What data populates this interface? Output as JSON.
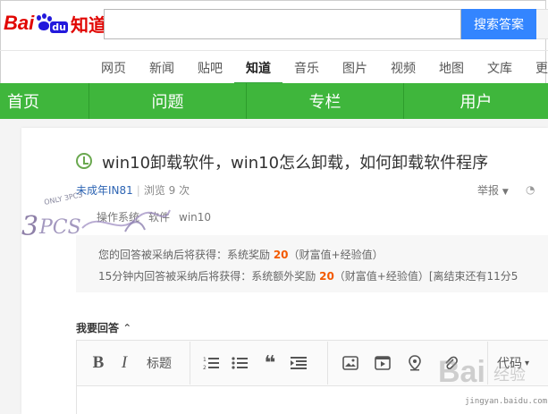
{
  "header": {
    "logo_bai": "Bai",
    "logo_du": "du",
    "logo_zhidao": "知道",
    "search_placeholder": "",
    "search_button": "搜索答案"
  },
  "nav": {
    "items": [
      "网页",
      "新闻",
      "贴吧",
      "知道",
      "音乐",
      "图片",
      "视频",
      "地图",
      "文库",
      "更"
    ],
    "active": "知道"
  },
  "greenbar": {
    "items": [
      "首页",
      "问题",
      "专栏",
      "用户"
    ]
  },
  "question": {
    "title": "win10卸载软件，win10怎么卸载，如何卸载软件程序",
    "asker": "未成年IN81",
    "views": "浏览 9 次",
    "report": "举报",
    "tags": [
      "操作系统",
      "软件",
      "win10"
    ]
  },
  "rewards": {
    "line1_prefix": "您的回答被采纳后将获得：系统奖励 ",
    "line1_num": "20",
    "line1_suffix": "（财富值+经验值）",
    "line2_prefix": "15分钟内回答被采纳后将获得：系统额外奖励 ",
    "line2_num": "20",
    "line2_suffix": "（财富值+经验值）[离结束还有11分5"
  },
  "answer": {
    "label": "我要回答"
  },
  "toolbar": {
    "bold": "B",
    "italic": "I",
    "heading": "标题",
    "code": "代码"
  },
  "watermark": {
    "left_text": "ONLY 3PCS",
    "site": "jingyan.baidu.com"
  },
  "colors": {
    "brand_red": "#e10602",
    "brand_blue": "#2319dc",
    "search_blue": "#3385ff",
    "green_bar": "#3fb63c",
    "reward_orange": "#f35a00",
    "link_blue": "#2d64b3"
  }
}
